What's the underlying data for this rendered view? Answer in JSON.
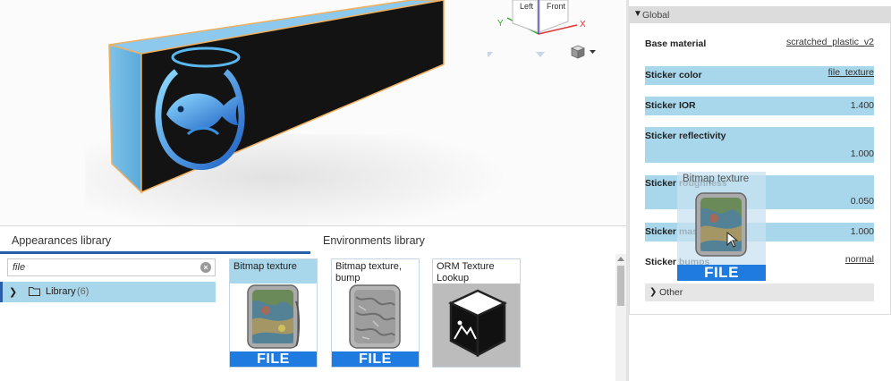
{
  "viewport": {
    "nav_cube": {
      "face_left": "Left",
      "face_front": "Front",
      "axis_x": "X",
      "axis_y": "Y"
    },
    "view_mode_icon": "cube-icon"
  },
  "library": {
    "tabs": [
      {
        "label": "Appearances library",
        "active": true
      },
      {
        "label": "Environments library",
        "active": false
      }
    ],
    "search": {
      "value": "file"
    },
    "tree": [
      {
        "label": "Library",
        "count": "(6)"
      }
    ],
    "cards": [
      {
        "title": "Bitmap texture",
        "badge": "FILE",
        "selected": true
      },
      {
        "title": "Bitmap texture, bump",
        "badge": "FILE",
        "selected": false
      },
      {
        "title": "ORM Texture Lookup",
        "badge": "",
        "selected": false
      }
    ]
  },
  "panel": {
    "section": "Global",
    "properties": [
      {
        "label": "Base material",
        "value": "scratched_plastic_v2",
        "link": true,
        "highlight": false
      },
      {
        "label": "Sticker color",
        "value": "file_texture",
        "link": true,
        "highlight": true
      },
      {
        "label": "Sticker IOR",
        "value": "1.400",
        "link": false,
        "highlight": true
      },
      {
        "label": "Sticker reflectivity",
        "value": "1.000",
        "link": false,
        "highlight": true
      },
      {
        "label": "Sticker roughness",
        "value": "0.050",
        "link": false,
        "highlight": true
      },
      {
        "label": "Sticker mask",
        "value": "1.000",
        "link": false,
        "highlight": true
      },
      {
        "label": "Sticker bumps",
        "value": "normal",
        "link": true,
        "highlight": false
      }
    ],
    "other": "Other"
  },
  "drag_ghost": {
    "title": "Bitmap texture",
    "badge": "FILE"
  },
  "colors": {
    "accent": "#2b5ea8",
    "highlight": "#a8d6ea",
    "file_badge": "#1f7be0"
  }
}
